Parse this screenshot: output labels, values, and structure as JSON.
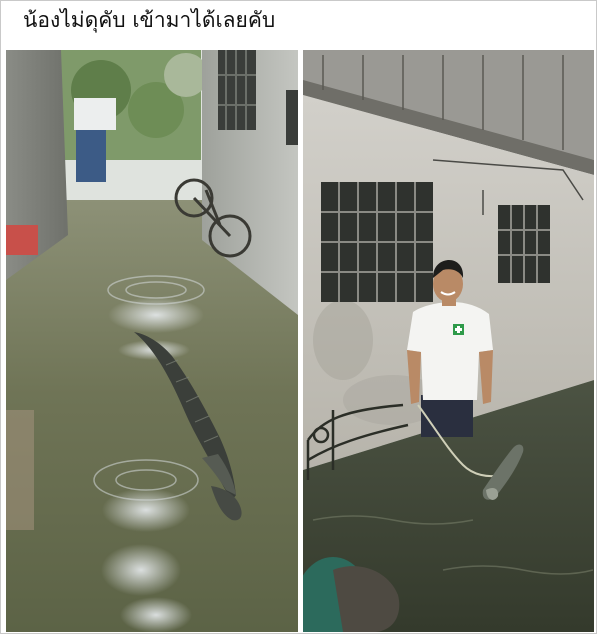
{
  "post": {
    "caption": "น้องไม่ดุคับ เข้ามาได้เลยคับ"
  },
  "photos": [
    {
      "subject": "flooded-alley-crocodile-swimming",
      "colors": {
        "water": "#6f7456",
        "wall": "#b9bcb7",
        "crocodile": "#3b3f3a"
      }
    },
    {
      "subject": "man-holding-crocodile-on-rope-in-flood",
      "colors": {
        "water": "#3f4535",
        "wall": "#c7c4bc",
        "shirt": "#f4f4f2",
        "logo": "#2e9a4a"
      }
    }
  ]
}
